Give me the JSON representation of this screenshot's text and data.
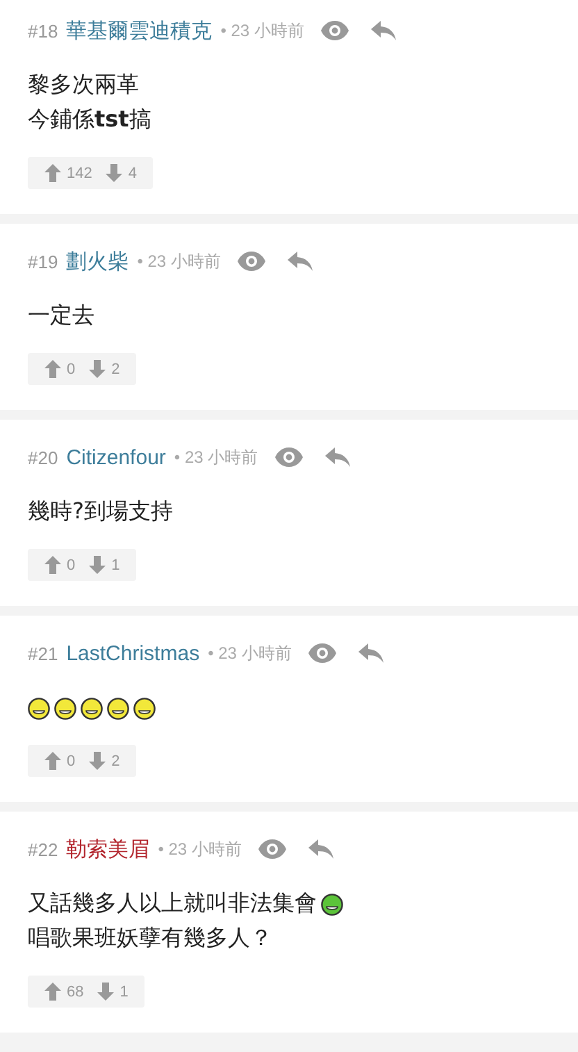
{
  "comments": [
    {
      "number": "#18",
      "user": "華基爾雲迪積克",
      "color": "#3d7d9a",
      "time": "• 23 小時前",
      "lines": [
        [
          {
            "kind": "text",
            "text": "黎多次兩革"
          }
        ],
        [
          {
            "kind": "text",
            "text": "今鋪係**tst**搞"
          }
        ]
      ],
      "upvotes": "142",
      "downvotes": "4"
    },
    {
      "number": "#19",
      "user": "劃火柴",
      "color": "#3d7d9a",
      "time": "• 23 小時前",
      "lines": [
        [
          {
            "kind": "text",
            "text": "一定去"
          }
        ]
      ],
      "upvotes": "0",
      "downvotes": "2"
    },
    {
      "number": "#20",
      "user": "Citizenfour",
      "color": "#3d7d9a",
      "time": "• 23 小時前",
      "lines": [
        [
          {
            "kind": "text",
            "text": "幾時?到場支持"
          }
        ]
      ],
      "upvotes": "0",
      "downvotes": "1"
    },
    {
      "number": "#21",
      "user": "LastChristmas",
      "color": "#3d7d9a",
      "time": "• 23 小時前",
      "lines": [
        [
          {
            "kind": "emoji",
            "color": "#f2e83a"
          },
          {
            "kind": "emoji",
            "color": "#f2e83a"
          },
          {
            "kind": "emoji",
            "color": "#f2e83a"
          },
          {
            "kind": "emoji",
            "color": "#f2e83a"
          },
          {
            "kind": "emoji",
            "color": "#f2e83a"
          }
        ]
      ],
      "upvotes": "0",
      "downvotes": "2"
    },
    {
      "number": "#22",
      "user": "勒索美眉",
      "color": "#b3262e",
      "time": "• 23 小時前",
      "lines": [
        [
          {
            "kind": "text",
            "text": "又話幾多人以上就叫非法集會"
          },
          {
            "kind": "emoji",
            "color": "#5cc43a"
          }
        ],
        [
          {
            "kind": "text",
            "text": "唱歌果班妖孽有幾多人？"
          }
        ]
      ],
      "upvotes": "68",
      "downvotes": "1"
    }
  ]
}
